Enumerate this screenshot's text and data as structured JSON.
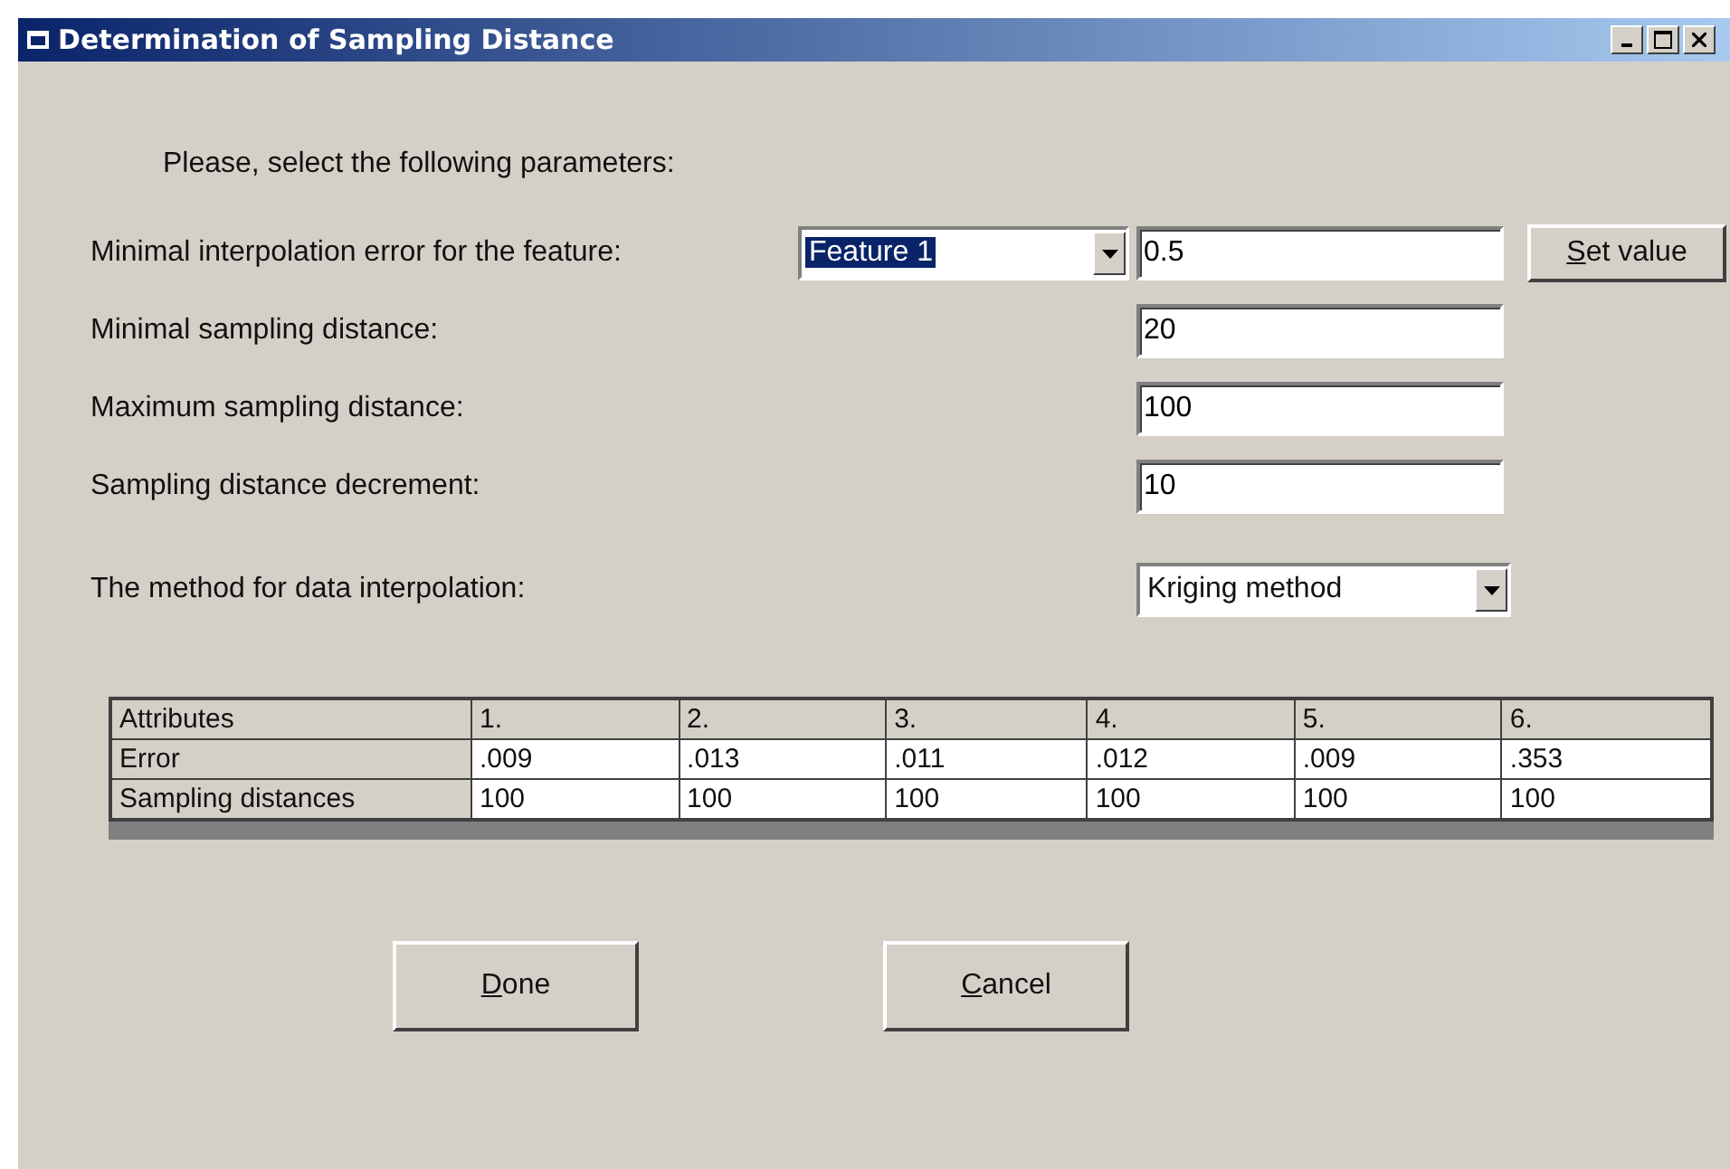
{
  "window": {
    "title": "Determination of Sampling Distance"
  },
  "prompt": "Please, select the following parameters:",
  "feature_row": {
    "label": "Minimal interpolation error for the feature:",
    "dropdown": {
      "value": "Feature 1",
      "selected": true
    },
    "value": "0.5",
    "button": {
      "mnemonic": "S",
      "rest": "et value"
    }
  },
  "fields": [
    {
      "label": "Minimal sampling distance:",
      "value": "20"
    },
    {
      "label": "Maximum sampling distance:",
      "value": "100"
    },
    {
      "label": "Sampling distance decrement:",
      "value": "10"
    }
  ],
  "method_row": {
    "label": "The method for data interpolation:",
    "dropdown": {
      "value": "Kriging method",
      "selected": false
    }
  },
  "table": {
    "columns": [
      "Attributes",
      "1.",
      "2.",
      "3.",
      "4.",
      "5.",
      "6."
    ],
    "rows": [
      [
        "Error",
        ".009",
        ".013",
        ".011",
        ".012",
        ".009",
        ".353"
      ],
      [
        "Sampling distances",
        "100",
        "100",
        "100",
        "100",
        "100",
        "100"
      ]
    ]
  },
  "buttons": [
    {
      "mnemonic": "D",
      "rest": "one"
    },
    {
      "mnemonic": "C",
      "rest": "ancel"
    }
  ]
}
